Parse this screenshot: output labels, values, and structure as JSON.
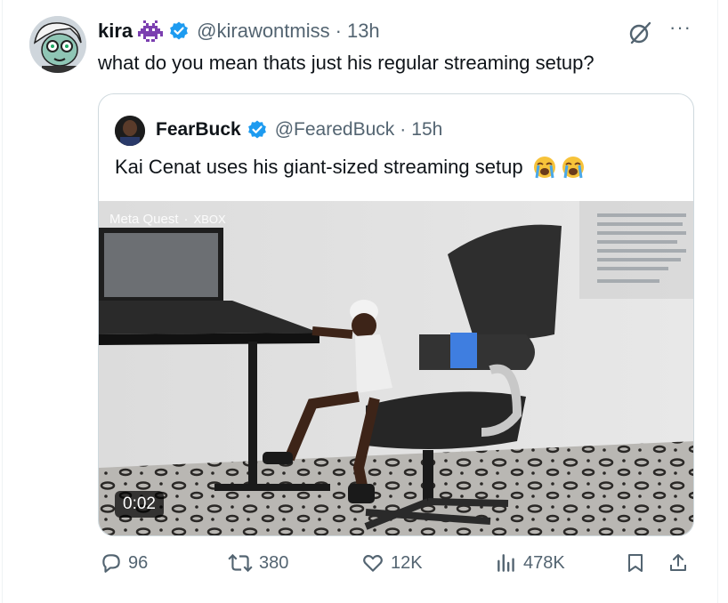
{
  "tweet": {
    "name": "kira",
    "handle": "@kirawontmiss",
    "separator": "·",
    "time": "13h",
    "text": "what do you mean thats just his regular streaming setup?"
  },
  "quote": {
    "name": "FearBuck",
    "handle": "@FearedBuck",
    "separator": "·",
    "time": "15h",
    "text": "Kai Cenat uses his giant-sized streaming setup",
    "video": {
      "duration": "0:02",
      "watermark_left": "Meta Quest",
      "watermark_right": "XBOX"
    }
  },
  "actions": {
    "replies": "96",
    "reposts": "380",
    "likes": "12K",
    "views": "478K"
  },
  "colors": {
    "verified": "#1d9bf0",
    "secondary_text": "#536471",
    "border": "#cfd9de"
  },
  "icons": [
    "verified-badge-icon",
    "space-invader-icon",
    "grok-icon",
    "more-icon",
    "reply-icon",
    "repost-icon",
    "like-icon",
    "views-icon",
    "bookmark-icon",
    "share-icon"
  ]
}
